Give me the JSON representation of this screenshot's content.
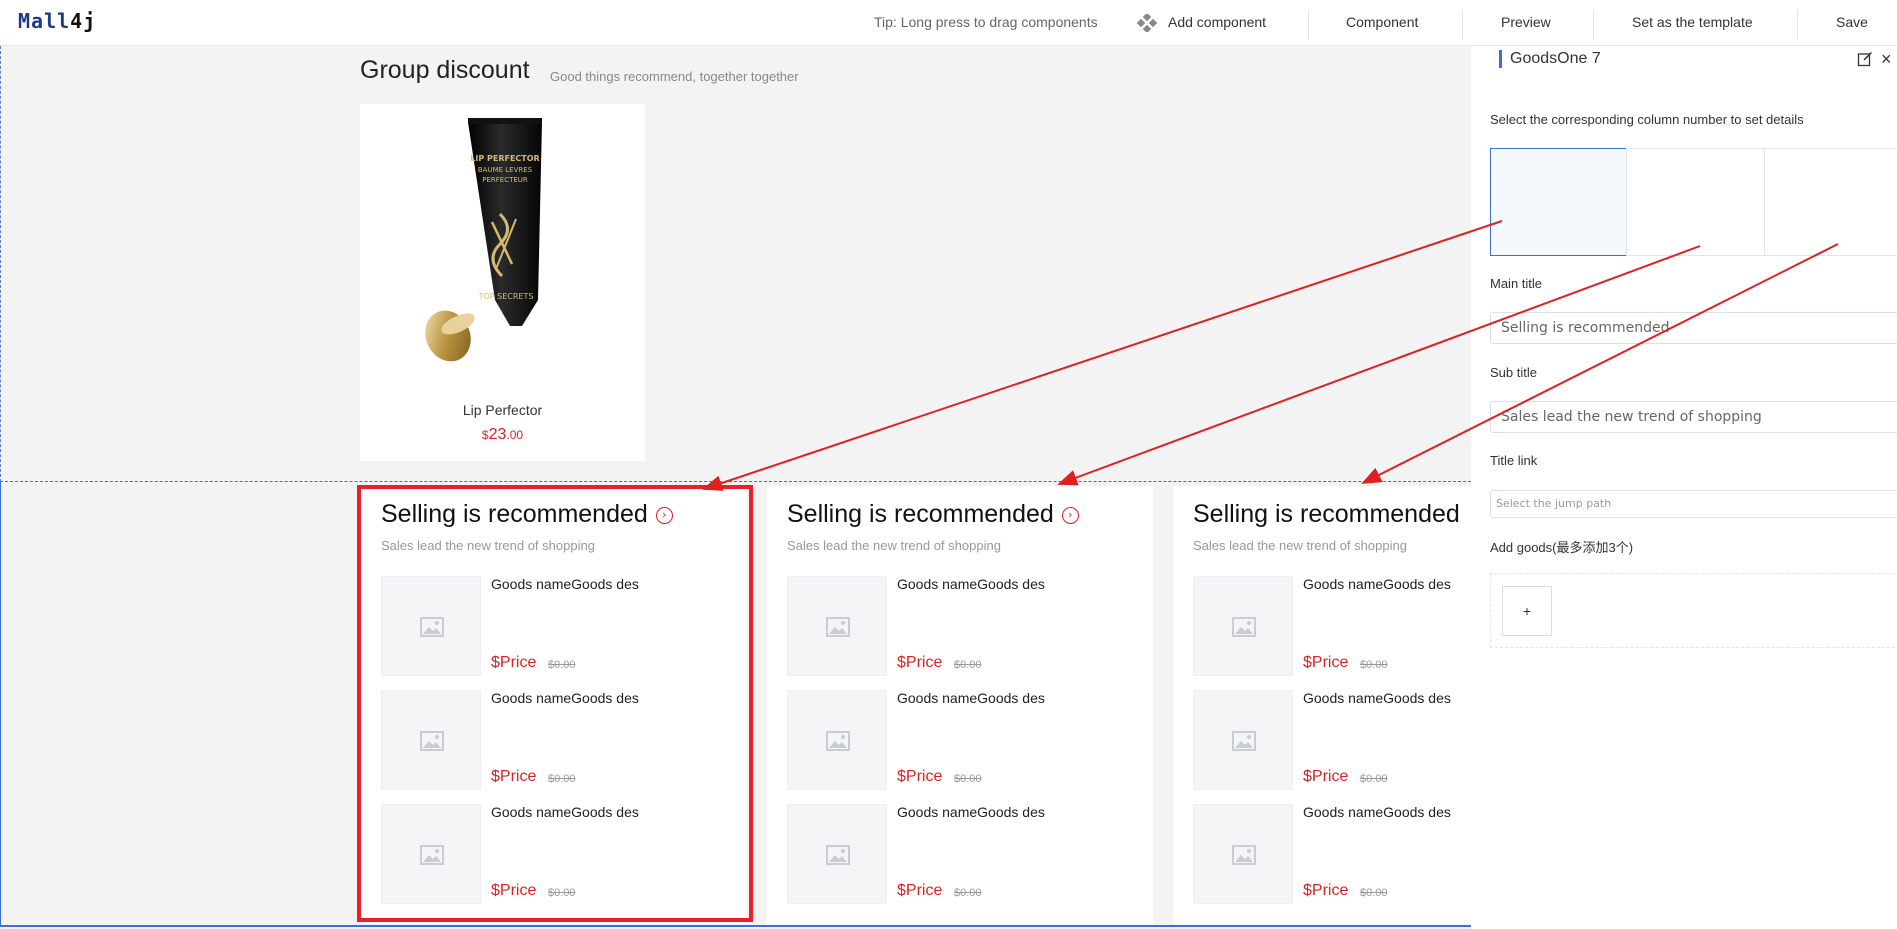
{
  "topbar": {
    "logo_text": "Mall",
    "logo_number": "4j",
    "tip": "Tip: Long press to drag components",
    "add_component": "Add component",
    "component": "Component",
    "preview": "Preview",
    "set_template": "Set as the template",
    "save": "Save"
  },
  "group_discount": {
    "title": "Group discount",
    "subtitle": "Good things recommend, together together",
    "product": {
      "brand_text": "LIP PERFECTOR\nBAUME LEVRES\nPERFECTEUR",
      "image_label": "TOP SECRETS",
      "name": "Lip Perfector",
      "price_currency": "$",
      "price_int": "23",
      "price_dec": ".00"
    }
  },
  "recommend_cards": [
    {
      "title": "Selling is recommended",
      "subtitle": "Sales lead the new trend of shopping",
      "goods": [
        {
          "name": "Goods nameGoods des",
          "price": "$Price",
          "old_price": "$0.00"
        },
        {
          "name": "Goods nameGoods des",
          "price": "$Price",
          "old_price": "$0.00"
        },
        {
          "name": "Goods nameGoods des",
          "price": "$Price",
          "old_price": "$0.00"
        }
      ]
    },
    {
      "title": "Selling is recommended",
      "subtitle": "Sales lead the new trend of shopping",
      "goods": [
        {
          "name": "Goods nameGoods des",
          "price": "$Price",
          "old_price": "$0.00"
        },
        {
          "name": "Goods nameGoods des",
          "price": "$Price",
          "old_price": "$0.00"
        },
        {
          "name": "Goods nameGoods des",
          "price": "$Price",
          "old_price": "$0.00"
        }
      ]
    },
    {
      "title": "Selling is recommended",
      "subtitle": "Sales lead the new trend of shopping",
      "goods": [
        {
          "name": "Goods nameGoods des",
          "price": "$Price",
          "old_price": "$0.00"
        },
        {
          "name": "Goods nameGoods des",
          "price": "$Price",
          "old_price": "$0.00"
        },
        {
          "name": "Goods nameGoods des",
          "price": "$Price",
          "old_price": "$0.00"
        }
      ]
    }
  ],
  "panel": {
    "title": "GoodsOne 7",
    "instruction": "Select the corresponding column number to set details",
    "main_title_label": "Main title",
    "main_title_value": "Selling is recommended",
    "sub_title_label": "Sub title",
    "sub_title_value": "Sales lead the new trend of shopping",
    "title_link_label": "Title link",
    "title_link_placeholder": "Select the jump path",
    "add_goods_label": "Add goods(最多添加3个)",
    "add_button": "+"
  },
  "colors": {
    "accent_blue": "#3b6ed6",
    "price_red": "#e02020",
    "highlight_red": "#e8202a",
    "canvas_bg": "#f3f3f3"
  }
}
